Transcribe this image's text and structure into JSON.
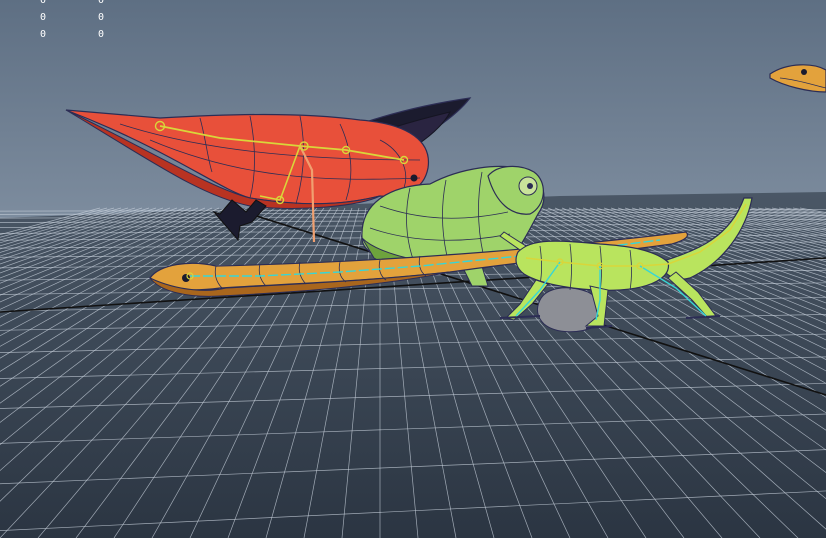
{
  "viewport": {
    "colors": {
      "sky_top": "#5e6f83",
      "sky_bottom": "#aab7c6",
      "floor_near": "#2b3542",
      "grid_line": "#c7d0db",
      "axis_line": "#111111",
      "bird_body": "#e8503a",
      "bird_shade": "#b83322",
      "wing_dark": "#1b1b2e",
      "chameleon_body": "#9fd36a",
      "chameleon_shade": "#6ea33d",
      "lizard_body": "#b9e45e",
      "snake_body": "#e3a23c",
      "snake_shade": "#a9661d",
      "bone_yellow": "#d9d63a",
      "bone_cyan": "#37d6d6",
      "wire": "#2c2d55",
      "rock": "#8d8f96"
    },
    "hud": {
      "row1_left": "0",
      "row1_right": "0",
      "row2_left": "0",
      "row2_right": "0",
      "row3_left": "0",
      "row3_right": "0"
    }
  }
}
